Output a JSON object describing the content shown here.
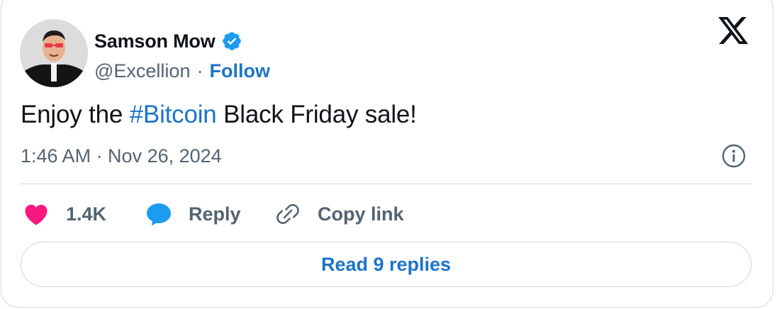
{
  "author": {
    "display_name": "Samson Mow",
    "handle": "@Excellion",
    "separator": "·",
    "follow_label": "Follow",
    "verified": true,
    "avatar_icon": "profile-photo"
  },
  "tweet": {
    "text_before": "Enjoy the ",
    "hashtag": "#Bitcoin",
    "text_after": " Black Friday sale!",
    "timestamp": "1:46 AM · Nov 26, 2024"
  },
  "actions": {
    "like_count": "1.4K",
    "reply_label": "Reply",
    "copy_link_label": "Copy link"
  },
  "read_replies_label": "Read 9 replies",
  "icons": {
    "platform": "x-logo-icon",
    "verified": "verified-badge-icon",
    "info": "info-icon",
    "like": "heart-icon",
    "reply": "speech-bubble-icon",
    "copy": "link-icon"
  },
  "colors": {
    "text": "#0f1419",
    "secondary": "#536471",
    "accent_blue": "#1d74c8",
    "verified_blue": "#1d9bf0",
    "heart": "#f91880",
    "border": "#cfd9de"
  }
}
